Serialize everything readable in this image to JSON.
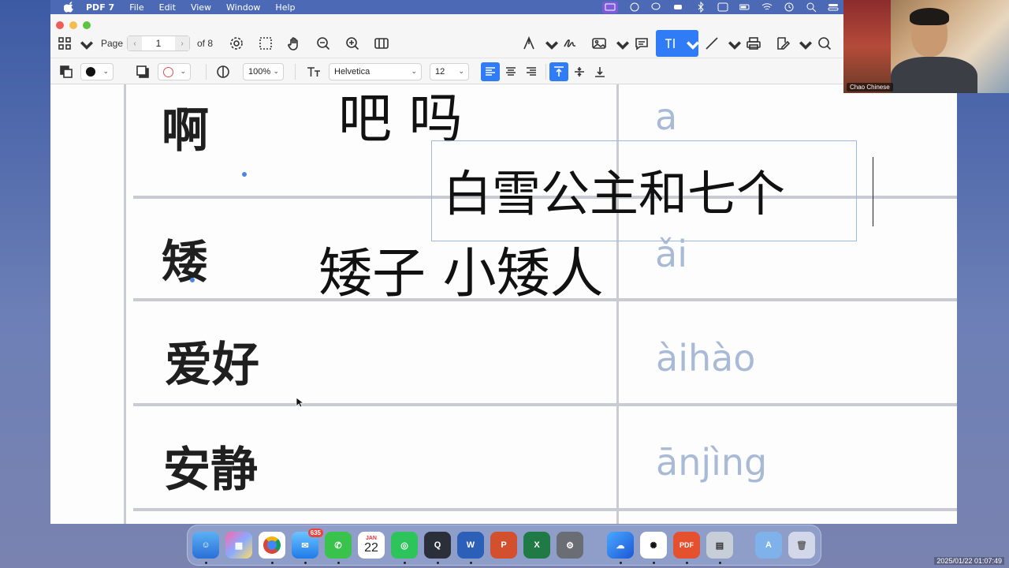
{
  "menubar": {
    "app_name": "PDF 7",
    "items": [
      "File",
      "Edit",
      "View",
      "Window",
      "Help"
    ]
  },
  "toolbar": {
    "page_label": "Page",
    "page_value": "1",
    "page_total": "of 8"
  },
  "format_bar": {
    "opacity": "100%",
    "font_family": "Helvetica",
    "font_size": "12"
  },
  "document": {
    "rows": [
      {
        "char": "啊",
        "example": "吧 吗",
        "pinyin": "a"
      },
      {
        "char": "矮",
        "example": "矮子 小矮人",
        "pinyin": "ǎi"
      },
      {
        "char": "爱好",
        "example": "",
        "pinyin": "àihào"
      },
      {
        "char": "安静",
        "example": "",
        "pinyin": "ānjìng"
      }
    ],
    "annotation_text": "白雪公主和七个"
  },
  "webcam": {
    "name": "Chao Chinese"
  },
  "dock": {
    "mail_badge": "635",
    "calendar_month": "JAN",
    "calendar_day": "22"
  },
  "timestamp": "2025/01/22 01:07:49",
  "colors": {
    "accent": "#2f7cf6",
    "pinyin": "#a8bad6",
    "menubar": "#4c69b5"
  }
}
